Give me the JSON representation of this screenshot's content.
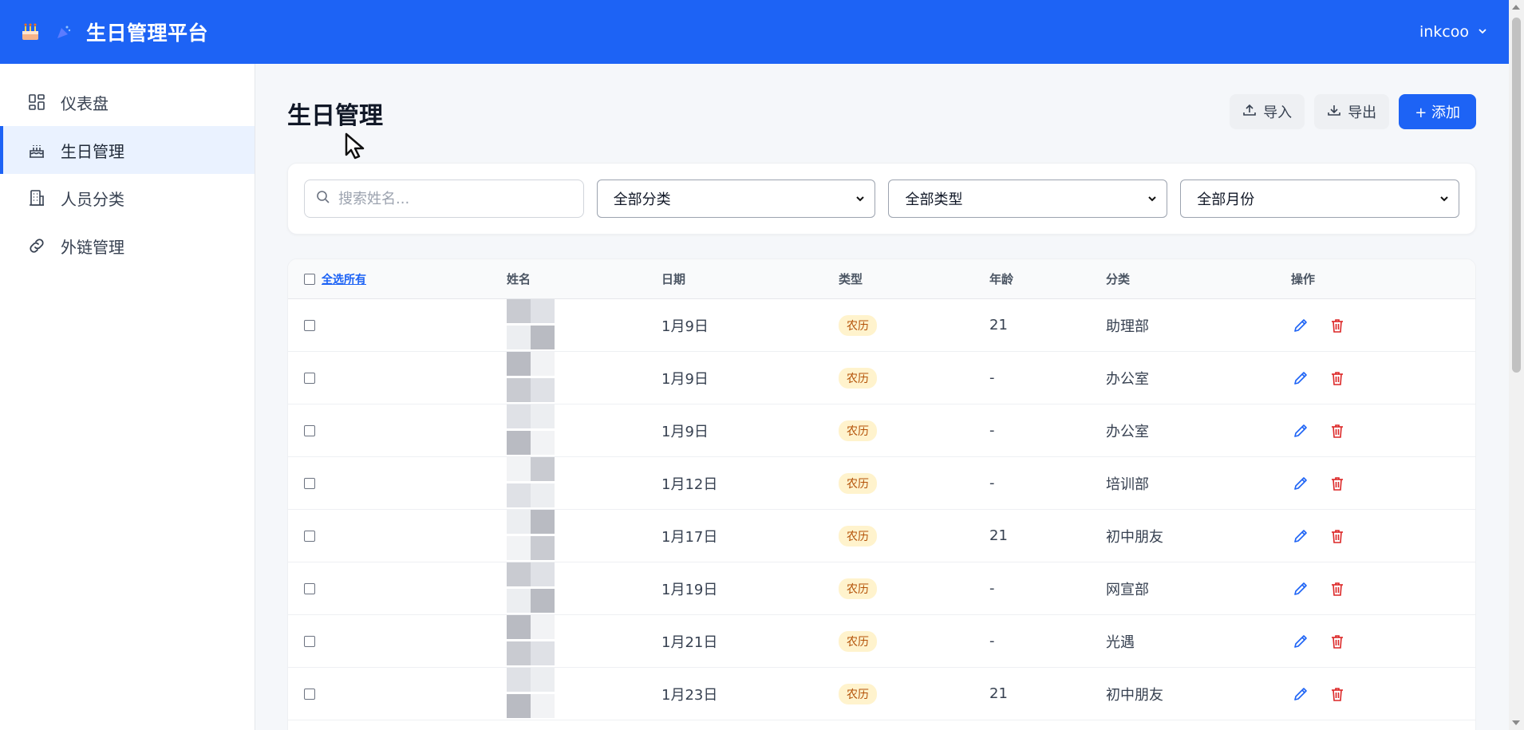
{
  "app": {
    "title": "生日管理平台",
    "user": "inkcoo"
  },
  "sidebar": {
    "items": [
      {
        "label": "仪表盘",
        "icon": "dashboard-icon",
        "active": false
      },
      {
        "label": "生日管理",
        "icon": "cake-icon",
        "active": true
      },
      {
        "label": "人员分类",
        "icon": "building-icon",
        "active": false
      },
      {
        "label": "外链管理",
        "icon": "link-icon",
        "active": false
      }
    ]
  },
  "page": {
    "title": "生日管理",
    "import_label": "导入",
    "export_label": "导出",
    "add_label": "+ 添加"
  },
  "filters": {
    "search_placeholder": "搜索姓名...",
    "category": "全部分类",
    "type": "全部类型",
    "month": "全部月份"
  },
  "table": {
    "select_all": "全选所有",
    "headers": [
      "姓名",
      "日期",
      "类型",
      "年龄",
      "分类",
      "操作"
    ],
    "rows": [
      {
        "date": "1月9日",
        "type": "农历",
        "age": "21",
        "category": "助理部"
      },
      {
        "date": "1月9日",
        "type": "农历",
        "age": "-",
        "category": "办公室"
      },
      {
        "date": "1月9日",
        "type": "农历",
        "age": "-",
        "category": "办公室"
      },
      {
        "date": "1月12日",
        "type": "农历",
        "age": "-",
        "category": "培训部"
      },
      {
        "date": "1月17日",
        "type": "农历",
        "age": "21",
        "category": "初中朋友"
      },
      {
        "date": "1月19日",
        "type": "农历",
        "age": "-",
        "category": "网宣部"
      },
      {
        "date": "1月21日",
        "type": "农历",
        "age": "-",
        "category": "光遇"
      },
      {
        "date": "1月23日",
        "type": "农历",
        "age": "21",
        "category": "初中朋友"
      }
    ]
  },
  "colors": {
    "primary": "#1d63f5",
    "badge_bg": "#fff3cd",
    "badge_text": "#b45309",
    "delete": "#dc2626"
  }
}
